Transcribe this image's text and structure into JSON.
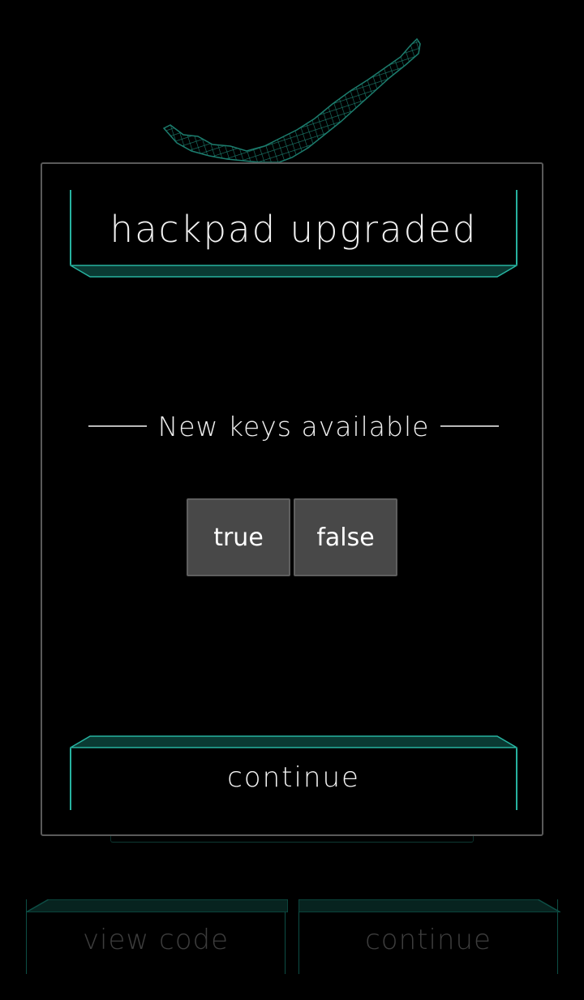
{
  "background": {
    "buttons": {
      "view_code_label": "view code",
      "continue_label": "continue"
    }
  },
  "modal": {
    "title": "hackpad upgraded",
    "subtitle": "New keys available",
    "keys": [
      {
        "label": "true"
      },
      {
        "label": "false"
      }
    ],
    "continue_label": "continue"
  },
  "colors": {
    "accent": "#27b3a0",
    "accent_dim": "#0d4e45",
    "key_bg": "#484848",
    "modal_border": "#5a5a5a",
    "background": "#000000"
  }
}
